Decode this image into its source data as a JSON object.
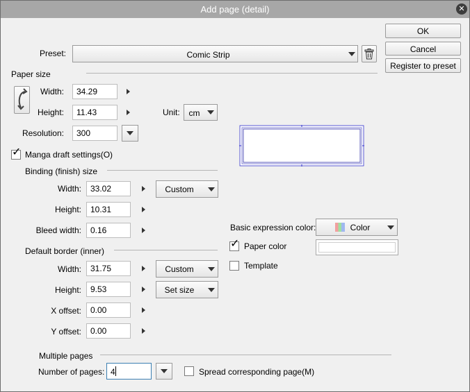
{
  "window": {
    "title": "Add page (detail)"
  },
  "buttons": {
    "ok": "OK",
    "cancel": "Cancel",
    "register": "Register to preset"
  },
  "preset": {
    "label": "Preset:",
    "value": "Comic Strip"
  },
  "paper_size": {
    "section": "Paper size",
    "width_label": "Width:",
    "width": "34.29",
    "height_label": "Height:",
    "height": "11.43",
    "unit_label": "Unit:",
    "unit": "cm",
    "resolution_label": "Resolution:",
    "resolution": "300"
  },
  "manga": {
    "label": "Manga draft settings(O)",
    "checked": true
  },
  "binding": {
    "section": "Binding (finish) size",
    "width_label": "Width:",
    "width": "33.02",
    "width_mode": "Custom",
    "height_label": "Height:",
    "height": "10.31",
    "bleed_label": "Bleed width:",
    "bleed": "0.16"
  },
  "border": {
    "section": "Default border (inner)",
    "width_label": "Width:",
    "width": "31.75",
    "width_mode": "Custom",
    "height_label": "Height:",
    "height": "9.53",
    "height_mode": "Set size",
    "xoffset_label": "X offset:",
    "xoffset": "0.00",
    "yoffset_label": "Y offset:",
    "yoffset": "0.00"
  },
  "expression": {
    "label": "Basic expression color:",
    "value": "Color"
  },
  "paper_color": {
    "label": "Paper color",
    "checked": true,
    "color": "#ffffff"
  },
  "template": {
    "label": "Template",
    "checked": false
  },
  "multiple": {
    "section": "Multiple pages",
    "count_label": "Number of pages:",
    "count": "4",
    "spread_label": "Spread corresponding page(M)",
    "spread_checked": false
  },
  "colors": {
    "titlebar": "#a7a7a7",
    "preview_frame": "#3333cc"
  }
}
